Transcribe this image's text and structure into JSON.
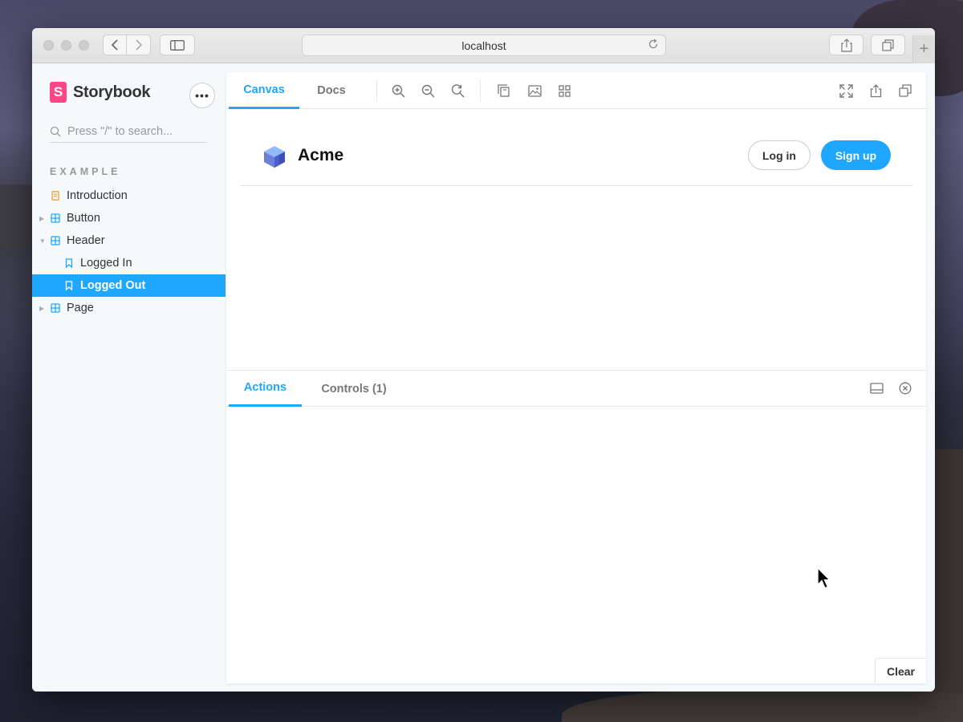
{
  "browser": {
    "url": "localhost"
  },
  "sidebar": {
    "brand": "Storybook",
    "menu_label": "•••",
    "search_placeholder": "Press \"/\" to search...",
    "section": "EXAMPLE",
    "items": [
      {
        "label": "Introduction",
        "icon": "doc-icon",
        "level": 0,
        "selected": false
      },
      {
        "label": "Button",
        "icon": "component-icon",
        "level": 0,
        "selected": false
      },
      {
        "label": "Header",
        "icon": "component-icon",
        "level": 0,
        "selected": false
      },
      {
        "label": "Logged In",
        "icon": "bookmark-icon",
        "level": 1,
        "selected": false
      },
      {
        "label": "Logged Out",
        "icon": "bookmark-icon",
        "level": 1,
        "selected": true
      },
      {
        "label": "Page",
        "icon": "component-icon",
        "level": 0,
        "selected": false
      }
    ]
  },
  "toolbar": {
    "tabs": [
      "Canvas",
      "Docs"
    ],
    "active_tab": "Canvas"
  },
  "preview": {
    "brand": "Acme",
    "login_label": "Log in",
    "signup_label": "Sign up"
  },
  "addons": {
    "tabs": [
      "Actions",
      "Controls (1)"
    ],
    "active_tab": "Actions",
    "clear_label": "Clear"
  },
  "colors": {
    "accent": "#1ea7fd",
    "storybook_pink": "#ff4785"
  }
}
